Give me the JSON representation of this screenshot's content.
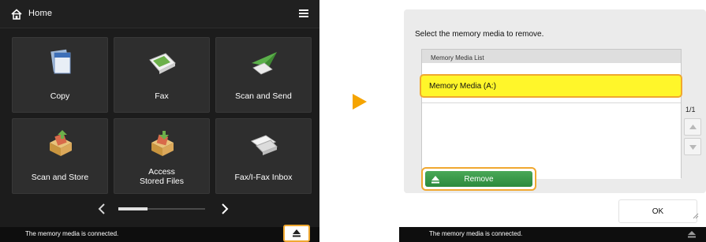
{
  "colors": {
    "accent_orange": "#f0a830",
    "selection_yellow": "#fff62a",
    "button_green": "#2b8a3c",
    "arrow_orange": "#f5a400"
  },
  "home": {
    "title": "Home",
    "icons": {
      "home": "home-icon",
      "menu": "menu-icon"
    },
    "tiles": [
      {
        "label": "Copy",
        "icon": "copy-icon"
      },
      {
        "label": "Fax",
        "icon": "fax-icon"
      },
      {
        "label": "Scan and Send",
        "icon": "scan-send-icon"
      },
      {
        "label": "Scan and Store",
        "icon": "scan-store-icon"
      },
      {
        "label": "Access Stored Files",
        "label_line1": "Access",
        "label_line2": "Stored Files",
        "icon": "access-files-icon"
      },
      {
        "label": "Fax/I-Fax Inbox",
        "icon": "fax-inbox-icon"
      }
    ],
    "pager": {
      "prev": "chevron-left-icon",
      "next": "chevron-right-icon",
      "page_fraction": 0.33
    },
    "status": "The memory media is connected.",
    "eject_icon": "eject-icon"
  },
  "dialog": {
    "prompt": "Select the memory media to remove.",
    "list_header": "Memory Media List",
    "items": [
      {
        "label": "Memory Media (A:)",
        "selected": true
      }
    ],
    "page_indicator": "1/1",
    "remove_label": "Remove",
    "ok_label": "OK",
    "status": "The memory media is connected."
  }
}
